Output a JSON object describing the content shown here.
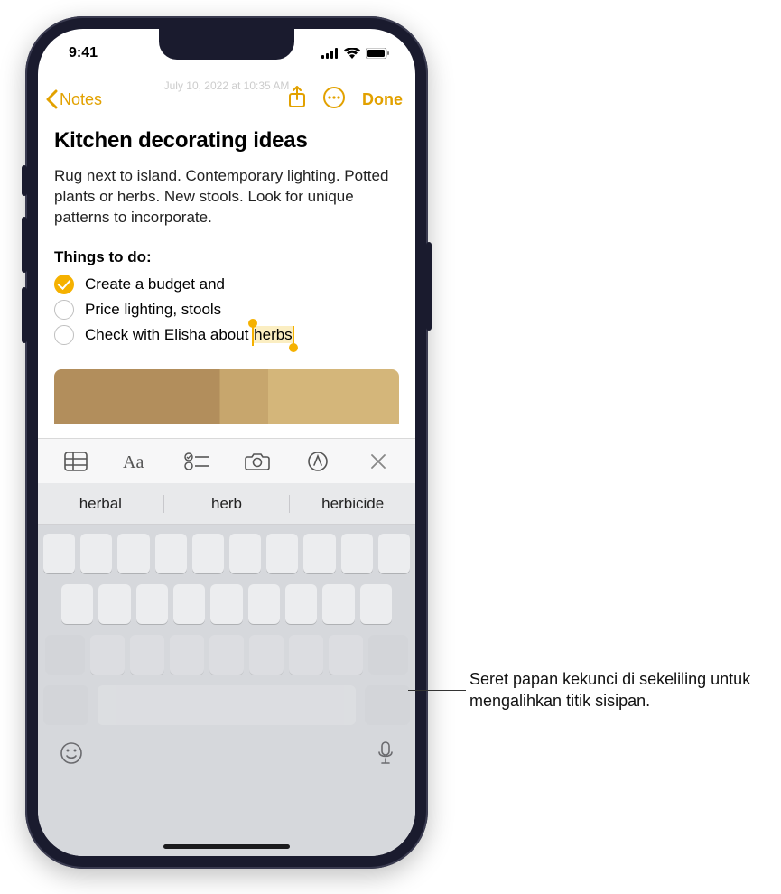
{
  "status": {
    "time": "9:41"
  },
  "nav": {
    "back_label": "Notes",
    "done_label": "Done",
    "timestamp": "July 10, 2022 at 10:35 AM"
  },
  "note": {
    "title": "Kitchen decorating ideas",
    "body": "Rug next to island. Contemporary lighting. Potted plants or herbs. New stools. Look for unique patterns to incorporate.",
    "subhead": "Things to do:",
    "items": [
      {
        "text": "Create a budget and",
        "checked": true
      },
      {
        "text": "Price lighting, stools",
        "checked": false
      },
      {
        "text_prefix": "Check with Elisha about ",
        "selected_word": "herbs",
        "checked": false
      }
    ]
  },
  "suggestions": [
    "herbal",
    "herb",
    "herbicide"
  ],
  "callout": "Seret papan kekunci di sekeliling untuk mengalihkan titik sisipan."
}
